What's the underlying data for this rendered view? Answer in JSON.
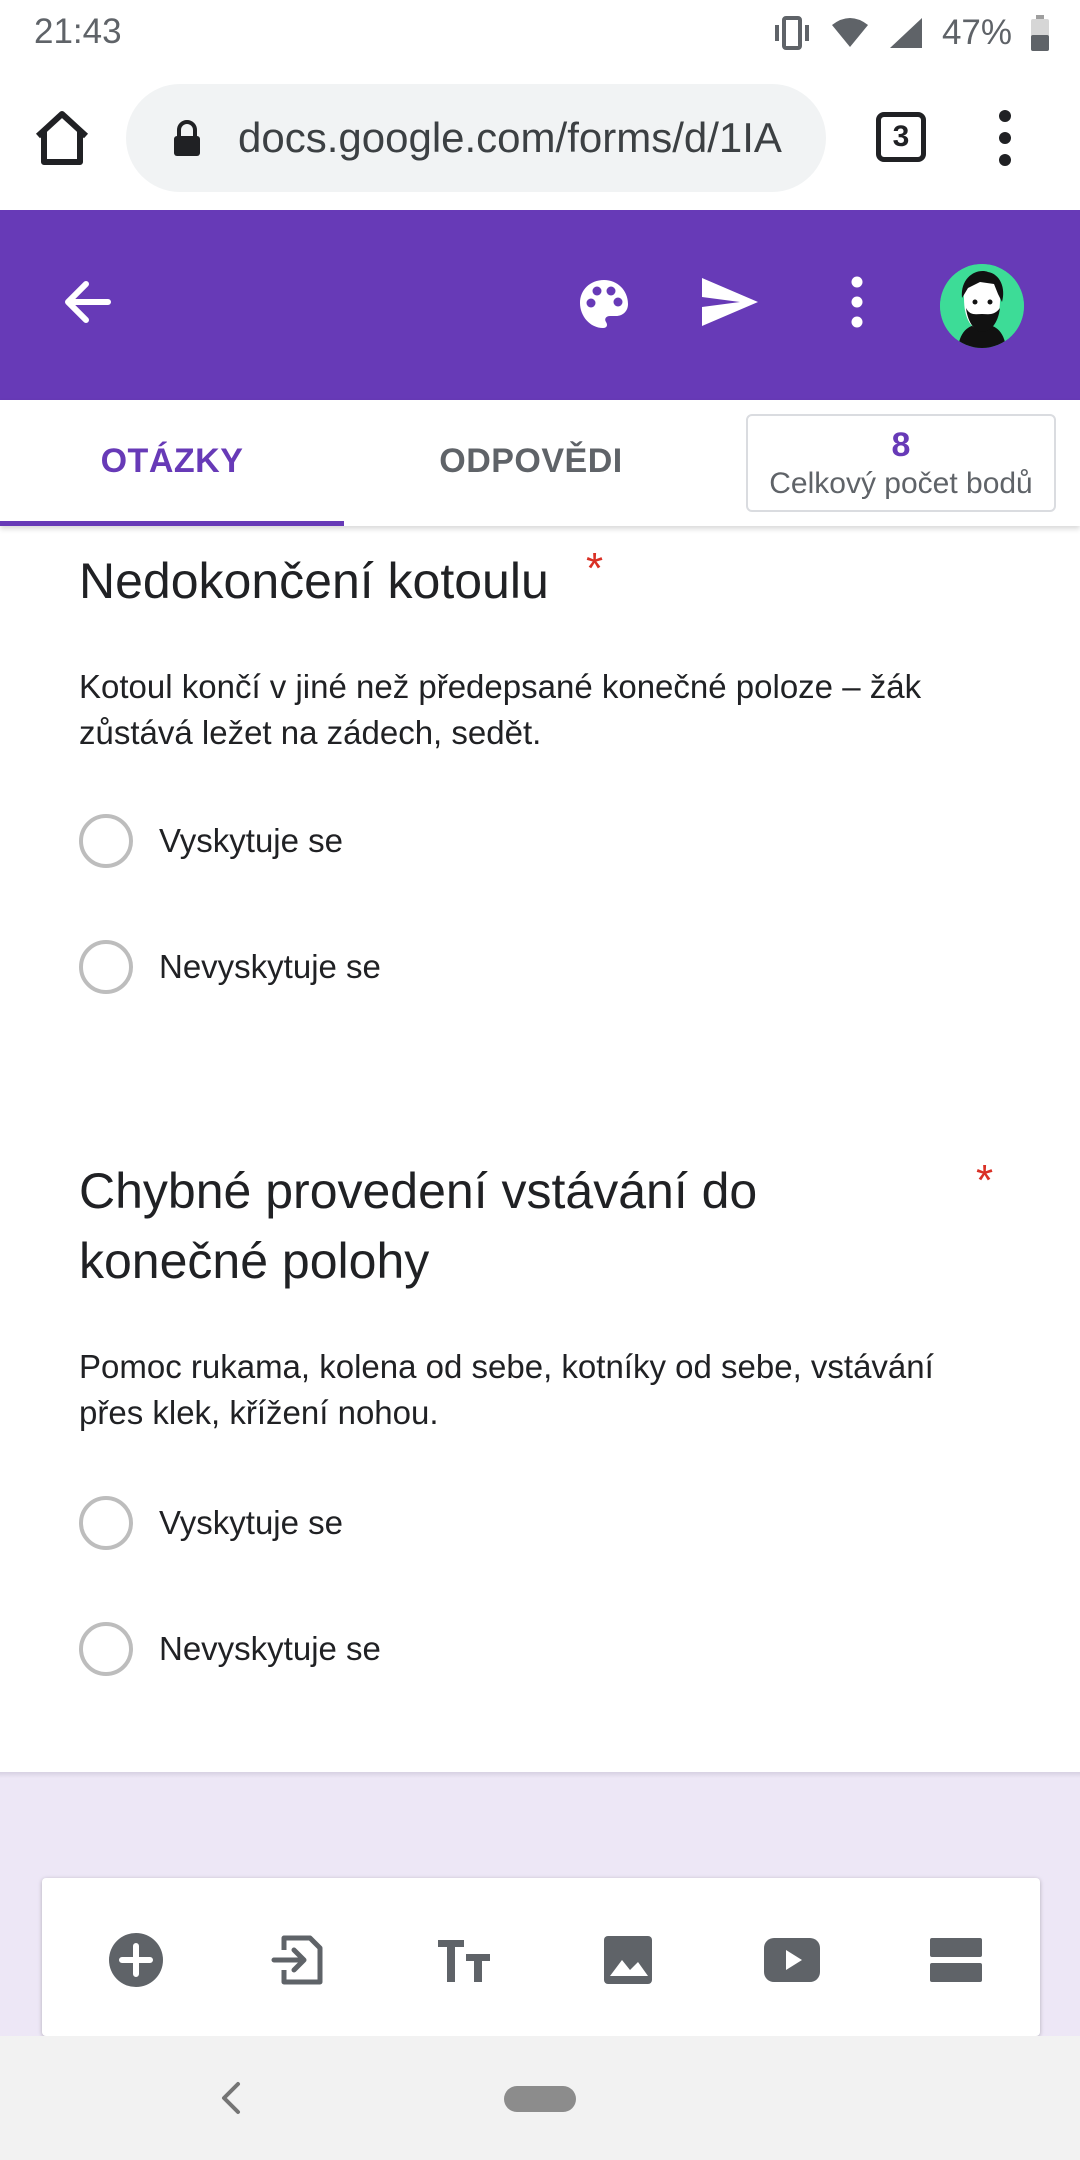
{
  "status_bar": {
    "time": "21:43",
    "battery": "47%"
  },
  "browser": {
    "url": "docs.google.com/forms/d/1IA",
    "tab_count": "3"
  },
  "tabs": [
    {
      "label": "OTÁZKY",
      "active": true
    },
    {
      "label": "ODPOVĚDI",
      "active": false
    }
  ],
  "points": {
    "value": "8",
    "label": "Celkový počet bodů"
  },
  "questions": [
    {
      "title": "Nedokončení kotoulu",
      "required_mark": "*",
      "description": "Kotoul končí v jiné než předepsané konečné poloze – žák zůstává ležet na zádech, sedět.",
      "options": [
        "Vyskytuje se",
        "Nevyskytuje se"
      ]
    },
    {
      "title_line1": "Chybné provedení vstávání do",
      "title_line2": "konečné polohy",
      "required_mark": "*",
      "description": "Pomoc rukama, kolena od sebe, kotníky od sebe, vstávání přes klek, křížení nohou.",
      "options": [
        "Vyskytuje se",
        "Nevyskytuje se"
      ]
    }
  ],
  "colors": {
    "accent": "#673ab7",
    "required": "#d93025",
    "background_lavender": "#ede7f6"
  },
  "icons": {
    "app_bar": [
      "back-arrow-icon",
      "palette-icon",
      "send-icon",
      "more-vert-icon",
      "avatar"
    ],
    "toolbar": [
      "add-question-icon",
      "import-questions-icon",
      "title-text-icon",
      "image-icon",
      "video-icon",
      "section-icon"
    ]
  }
}
